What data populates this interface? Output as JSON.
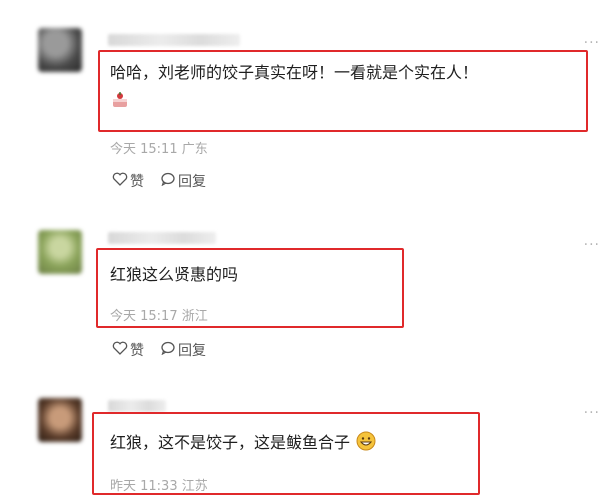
{
  "comments": [
    {
      "text": "哈哈，刘老师的饺子真实在呀！一看就是个实在人！",
      "emoji": "cake-emoji",
      "time": "今天 15:11",
      "location": "广东",
      "like_label": "赞",
      "reply_label": "回复"
    },
    {
      "text": "红狼这么贤惠的吗",
      "time": "今天 15:17",
      "location": "浙江",
      "like_label": "赞",
      "reply_label": "回复"
    },
    {
      "text": "红狼，这不是饺子，这是鲅鱼合子",
      "emoji": "grin-emoji",
      "time": "昨天 11:33",
      "location": "江苏"
    }
  ],
  "more_label": "···",
  "colors": {
    "highlight": "#e0292b",
    "meta": "#a8a8a8"
  }
}
